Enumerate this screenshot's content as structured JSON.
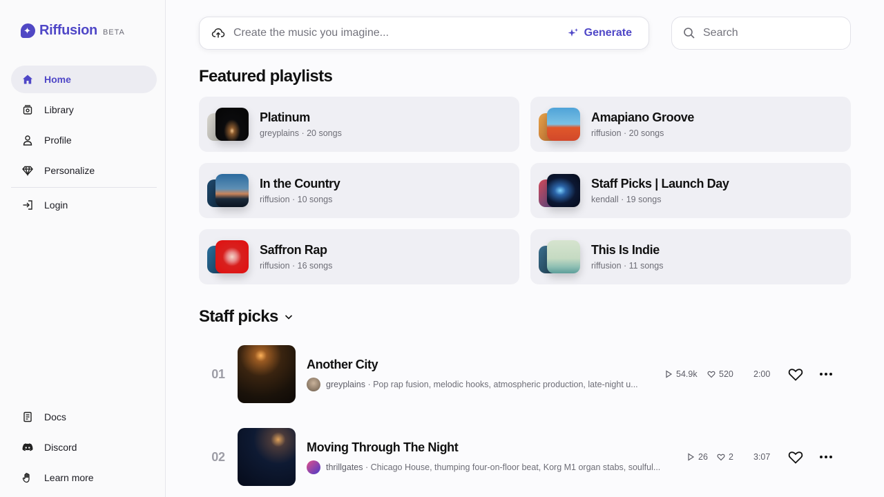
{
  "brand": {
    "name": "Riffusion",
    "badge": "BETA"
  },
  "nav": {
    "items": [
      {
        "label": "Home",
        "icon": "home-icon",
        "active": true
      },
      {
        "label": "Library",
        "icon": "library-icon"
      },
      {
        "label": "Profile",
        "icon": "user-icon"
      },
      {
        "label": "Personalize",
        "icon": "diamond-icon"
      }
    ],
    "login": {
      "label": "Login",
      "icon": "login-icon"
    },
    "bottom": [
      {
        "label": "Docs",
        "icon": "document-icon"
      },
      {
        "label": "Discord",
        "icon": "discord-icon"
      },
      {
        "label": "Learn more",
        "icon": "hand-icon"
      }
    ]
  },
  "generate": {
    "placeholder": "Create the music you imagine...",
    "button_label": "Generate"
  },
  "search": {
    "placeholder": "Search"
  },
  "featured": {
    "heading": "Featured playlists",
    "playlists": [
      {
        "title": "Platinum",
        "subtitle": "greyplains · 20 songs"
      },
      {
        "title": "Amapiano Groove",
        "subtitle": "riffusion · 20 songs"
      },
      {
        "title": "In the Country",
        "subtitle": "riffusion · 10 songs"
      },
      {
        "title": "Staff Picks | Launch Day",
        "subtitle": "kendall · 19 songs"
      },
      {
        "title": "Saffron Rap",
        "subtitle": "riffusion · 16 songs"
      },
      {
        "title": "This Is Indie",
        "subtitle": "riffusion · 11 songs"
      }
    ]
  },
  "staff_picks": {
    "heading": "Staff picks",
    "tracks": [
      {
        "number": "01",
        "title": "Another City",
        "user": "greyplains",
        "description": "Pop rap fusion, melodic hooks, atmospheric production, late-night u...",
        "plays": "54.9k",
        "likes": "520",
        "duration": "2:00"
      },
      {
        "number": "02",
        "title": "Moving Through The Night",
        "user": "thrillgates",
        "description": "Chicago House, thumping four-on-floor beat, Korg M1 organ stabs, soulful...",
        "plays": "26",
        "likes": "2",
        "duration": "3:07"
      }
    ]
  },
  "colors": {
    "accent": "#4f47c7",
    "panel": "#efeff4",
    "background": "#fbfbfd"
  }
}
